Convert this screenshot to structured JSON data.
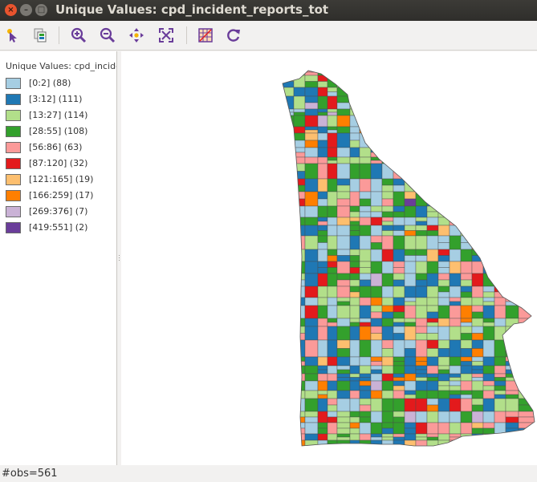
{
  "window": {
    "title": "Unique Values: cpd_incident_reports_tot"
  },
  "toolbar": {
    "tools": [
      "select-tool-icon",
      "copy-image-icon",
      "zoom-in-icon",
      "zoom-out-icon",
      "pan-icon",
      "fit-extent-icon",
      "map-layer-icon",
      "refresh-icon"
    ]
  },
  "legend": {
    "title": "Unique Values: cpd_incide",
    "items": [
      {
        "label": "[0:2] (88)",
        "color": "#a6cee3"
      },
      {
        "label": "[3:12] (111)",
        "color": "#1f78b4"
      },
      {
        "label": "[13:27] (114)",
        "color": "#b2df8a"
      },
      {
        "label": "[28:55] (108)",
        "color": "#33a02c"
      },
      {
        "label": "[56:86] (63)",
        "color": "#fb9a99"
      },
      {
        "label": "[87:120] (32)",
        "color": "#e31a1c"
      },
      {
        "label": "[121:165] (19)",
        "color": "#fdbf6f"
      },
      {
        "label": "[166:259] (17)",
        "color": "#ff7f00"
      },
      {
        "label": "[269:376] (7)",
        "color": "#cab2d6"
      },
      {
        "label": "[419:551] (2)",
        "color": "#6a3d9a"
      }
    ]
  },
  "status": {
    "text": "#obs=561"
  }
}
